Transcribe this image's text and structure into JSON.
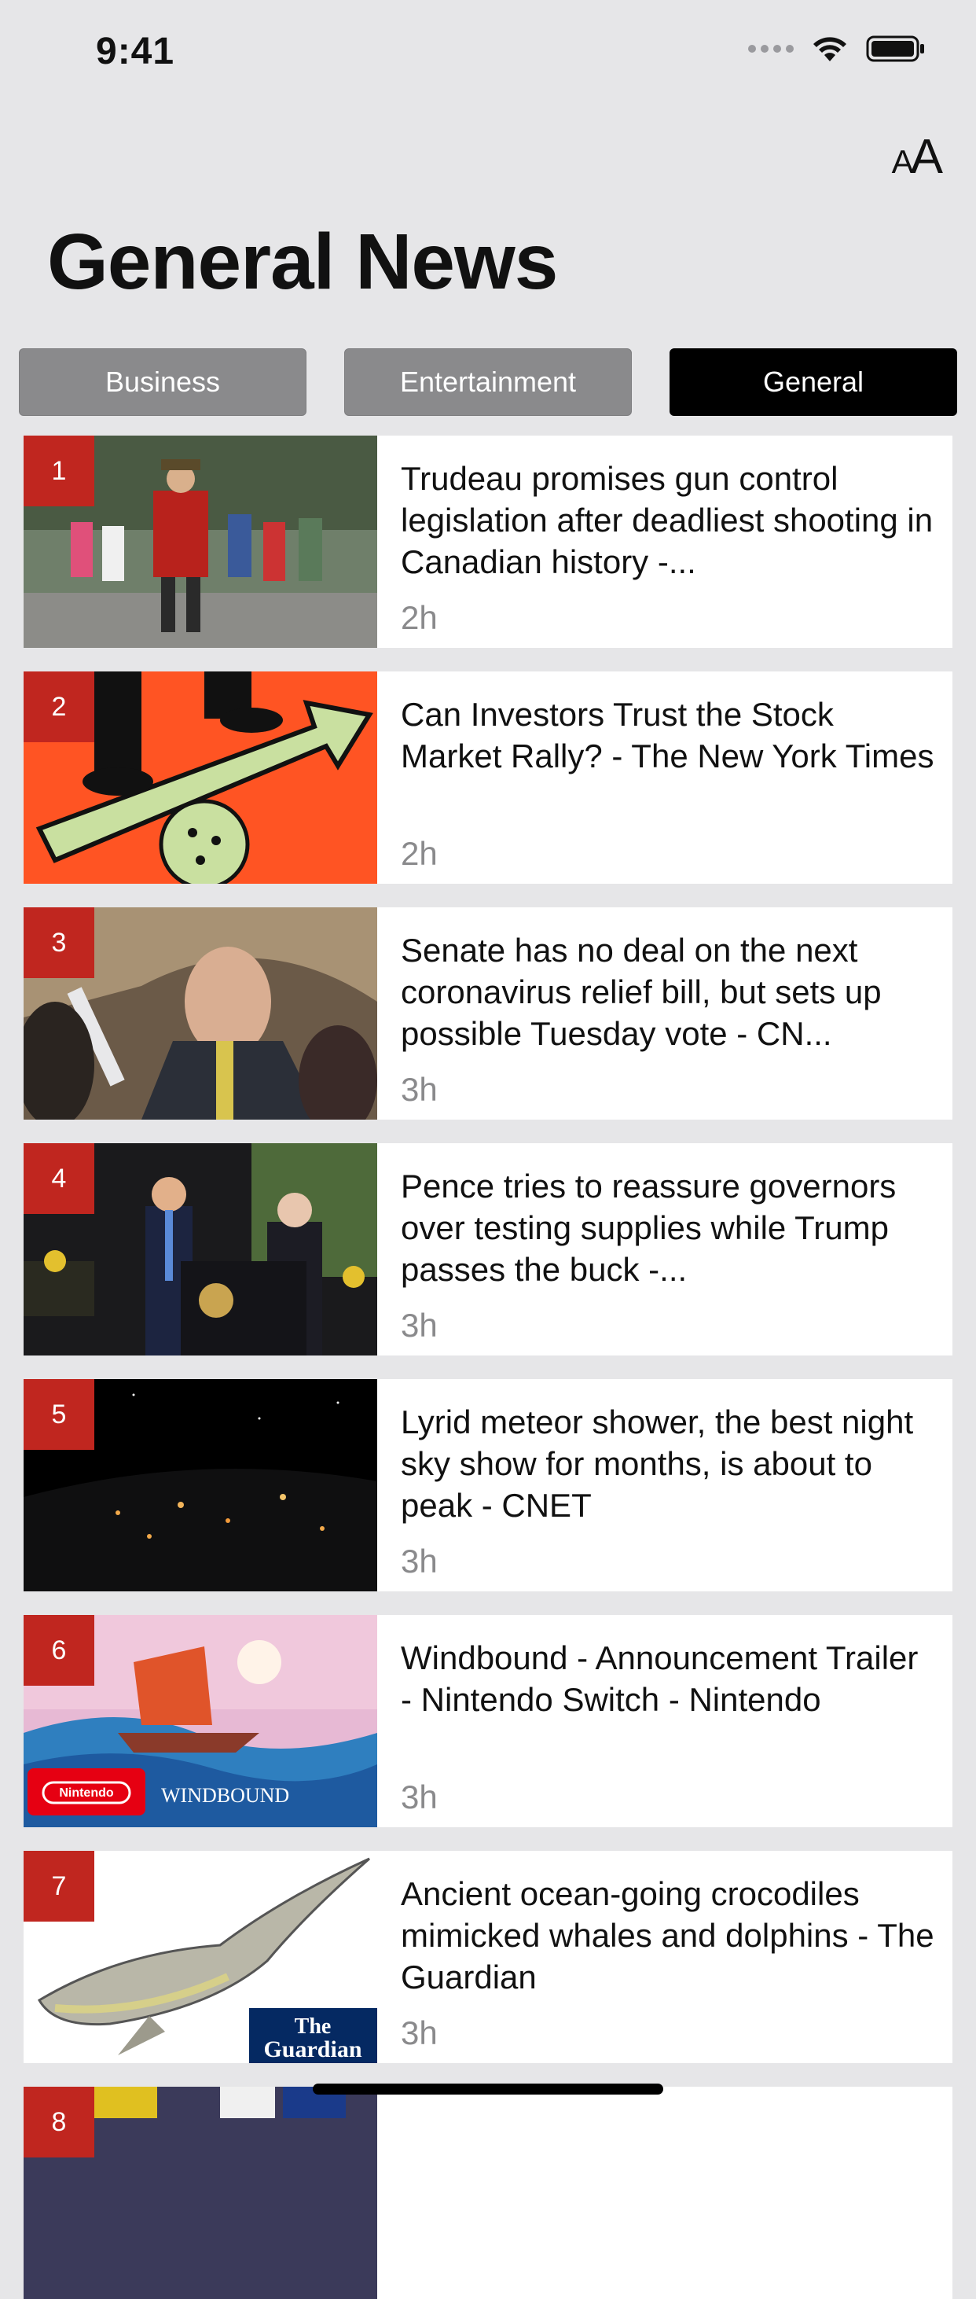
{
  "status": {
    "time": "9:41"
  },
  "header": {
    "font_size_label_small": "A",
    "font_size_label_large": "A",
    "title": "General News"
  },
  "tabs": [
    {
      "label": "Business",
      "active": false
    },
    {
      "label": "Entertainment",
      "active": false
    },
    {
      "label": "General",
      "active": true
    }
  ],
  "articles": [
    {
      "rank": "1",
      "title": "Trudeau promises gun control legislation after deadliest shooting in Canadian history -...",
      "age": "2h"
    },
    {
      "rank": "2",
      "title": "Can Investors Trust the Stock Market Rally? - The New York Times",
      "age": "2h"
    },
    {
      "rank": "3",
      "title": "Senate has no deal on the next coronavirus relief bill, but sets up possible Tuesday vote - CN...",
      "age": "3h"
    },
    {
      "rank": "4",
      "title": "Pence tries to reassure governors over testing supplies while Trump passes the buck -...",
      "age": "3h"
    },
    {
      "rank": "5",
      "title": "Lyrid meteor shower, the best night sky show for months, is about to peak - CNET",
      "age": "3h"
    },
    {
      "rank": "6",
      "title": "Windbound - Announcement Trailer - Nintendo Switch - Nintendo",
      "age": "3h",
      "thumb_text": [
        "Nintendo",
        "WINDBOUND"
      ]
    },
    {
      "rank": "7",
      "title": "Ancient ocean-going crocodiles mimicked whales and dolphins - The Guardian",
      "age": "3h",
      "thumb_text": [
        "The",
        "Guardian"
      ]
    },
    {
      "rank": "8"
    }
  ],
  "colors": {
    "badge": "#c0261f",
    "active_tab": "#000000",
    "inactive_tab": "#8a8a8c",
    "background": "#e6e6e8"
  }
}
